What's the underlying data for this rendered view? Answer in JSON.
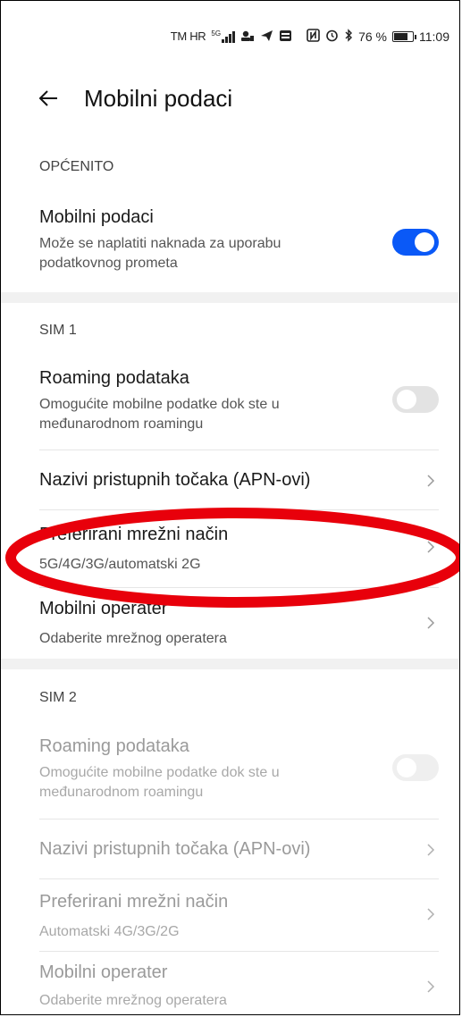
{
  "status_bar": {
    "carrier": "TM HR",
    "network": "5G",
    "battery_text": "76 %",
    "battery_level": 0.76,
    "time": "11:09",
    "icons": [
      "signal-icon",
      "data-saver-icon",
      "send-icon",
      "message-icon",
      "nfc-icon",
      "alarm-icon",
      "bluetooth-icon",
      "battery-icon"
    ]
  },
  "header": {
    "title": "Mobilni podaci",
    "back_icon": "back-arrow-icon"
  },
  "general": {
    "label": "OPĆENITO",
    "mobile_data": {
      "title": "Mobilni podaci",
      "subtitle": "Može se naplatiti naknada za uporabu podatkovnog prometa",
      "enabled": true
    }
  },
  "sim1": {
    "label": "SIM 1",
    "roaming": {
      "title": "Roaming podataka",
      "subtitle": "Omogućite mobilne podatke dok ste u međunarodnom roamingu",
      "enabled": false
    },
    "apn": {
      "title": "Nazivi pristupnih točaka (APN-ovi)"
    },
    "network_mode": {
      "title": "Preferirani mrežni način",
      "subtitle": "5G/4G/3G/automatski 2G"
    },
    "operator": {
      "title": "Mobilni operater",
      "subtitle": "Odaberite mrežnog operatera"
    }
  },
  "sim2": {
    "label": "SIM 2",
    "roaming": {
      "title": "Roaming podataka",
      "subtitle": "Omogućite mobilne podatke dok ste u međunarodnom roamingu",
      "enabled": false
    },
    "apn": {
      "title": "Nazivi pristupnih točaka (APN-ovi)"
    },
    "network_mode": {
      "title": "Preferirani mrežni način",
      "subtitle": "Automatski 4G/3G/2G"
    },
    "operator": {
      "title": "Mobilni operater",
      "subtitle": "Odaberite mrežnog operatera"
    }
  },
  "colors": {
    "accent": "#0a59f7",
    "highlight": "#e8000b"
  }
}
